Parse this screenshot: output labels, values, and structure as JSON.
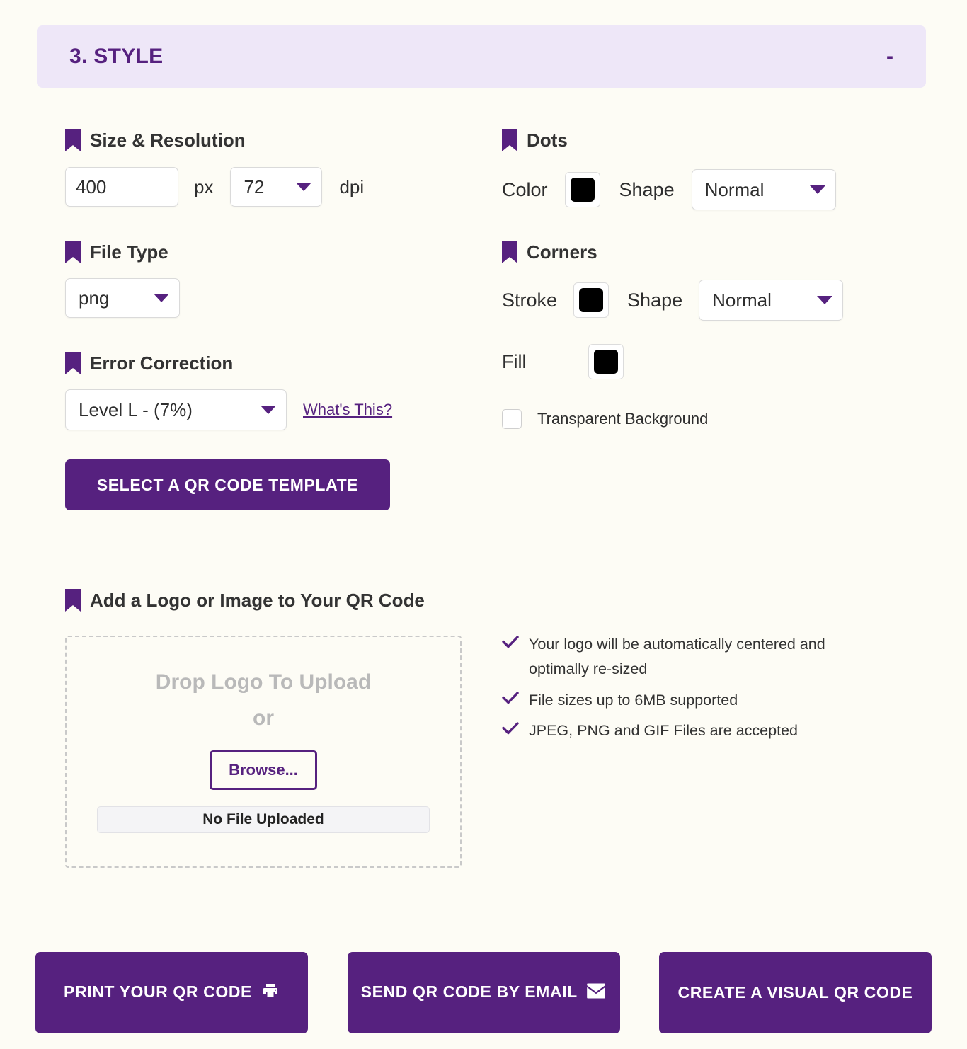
{
  "section": {
    "title": "3. STYLE",
    "collapse_toggle": "-",
    "header_bg": "#EEE7F8",
    "accent": "#56217F"
  },
  "size_resolution": {
    "heading": "Size & Resolution",
    "size_value": "400",
    "size_placeholder": "400",
    "size_unit": "px",
    "dpi_value": "72",
    "dpi_unit": "dpi"
  },
  "file_type": {
    "heading": "File Type",
    "value": "png"
  },
  "error_correction": {
    "heading": "Error Correction",
    "value": "Level L - (7%)",
    "help_link": "What's This?"
  },
  "dots": {
    "heading": "Dots",
    "color_label": "Color",
    "color_value": "#000000",
    "shape_label": "Shape",
    "shape_value": "Normal"
  },
  "corners": {
    "heading": "Corners",
    "stroke_label": "Stroke",
    "stroke_value": "#000000",
    "shape_label": "Shape",
    "shape_value": "Normal",
    "fill_label": "Fill",
    "fill_value": "#000000",
    "transparent_label": "Transparent Background",
    "transparent_checked": false
  },
  "template_button": "SELECT A QR CODE TEMPLATE",
  "logo": {
    "heading": "Add a Logo or Image to Your QR Code",
    "drop_text": "Drop Logo To Upload",
    "or_text": "or",
    "browse_label": "Browse...",
    "file_status": "No File Uploaded",
    "features": [
      "Your logo will be automatically centered and optimally re-sized",
      "File sizes up to 6MB supported",
      "JPEG, PNG and GIF Files are accepted"
    ]
  },
  "actions": {
    "print": "PRINT YOUR QR CODE",
    "print_icon": "printer-icon",
    "email": "SEND QR CODE BY EMAIL",
    "email_icon": "envelope-icon",
    "visual": "CREATE A VISUAL QR CODE"
  }
}
